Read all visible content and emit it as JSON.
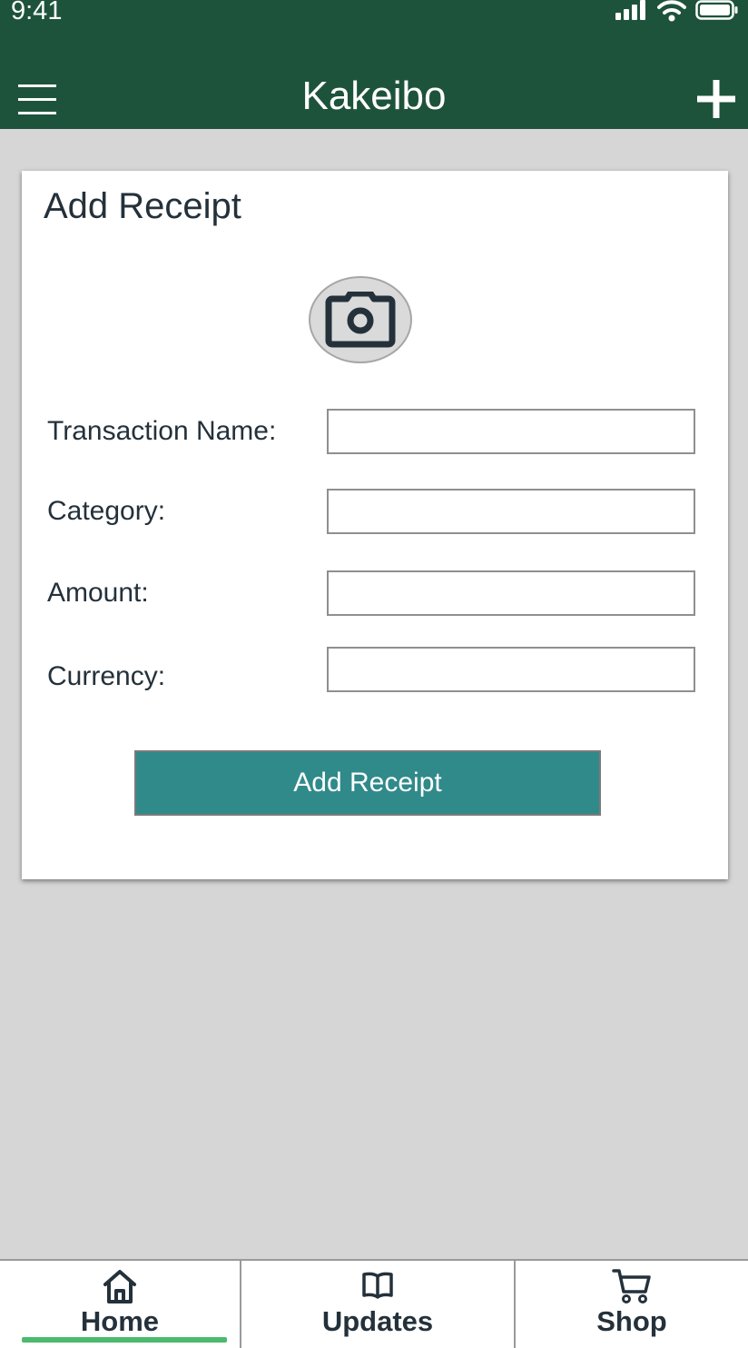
{
  "status_bar": {
    "time": "9:41"
  },
  "header": {
    "title": "Kakeibo",
    "menu_icon": "hamburger-menu-icon",
    "add_icon": "plus-icon",
    "background_color": "#1e533b"
  },
  "add_receipt_card": {
    "title": "Add Receipt",
    "camera_icon": "camera-icon",
    "fields": [
      {
        "label": "Transaction Name:",
        "value": "",
        "placeholder": ""
      },
      {
        "label": "Category:",
        "value": "",
        "placeholder": ""
      },
      {
        "label": "Amount:",
        "value": "",
        "placeholder": ""
      },
      {
        "label": "Currency:",
        "value": "",
        "placeholder": ""
      }
    ],
    "submit_label": "Add Receipt",
    "submit_color": "#318a8a"
  },
  "bottom_nav": {
    "items": [
      {
        "label": "Home",
        "icon": "home-icon",
        "active": true
      },
      {
        "label": "Updates",
        "icon": "book-icon",
        "active": false
      },
      {
        "label": "Shop",
        "icon": "cart-icon",
        "active": false
      }
    ],
    "active_indicator_color": "#4cba6e"
  }
}
